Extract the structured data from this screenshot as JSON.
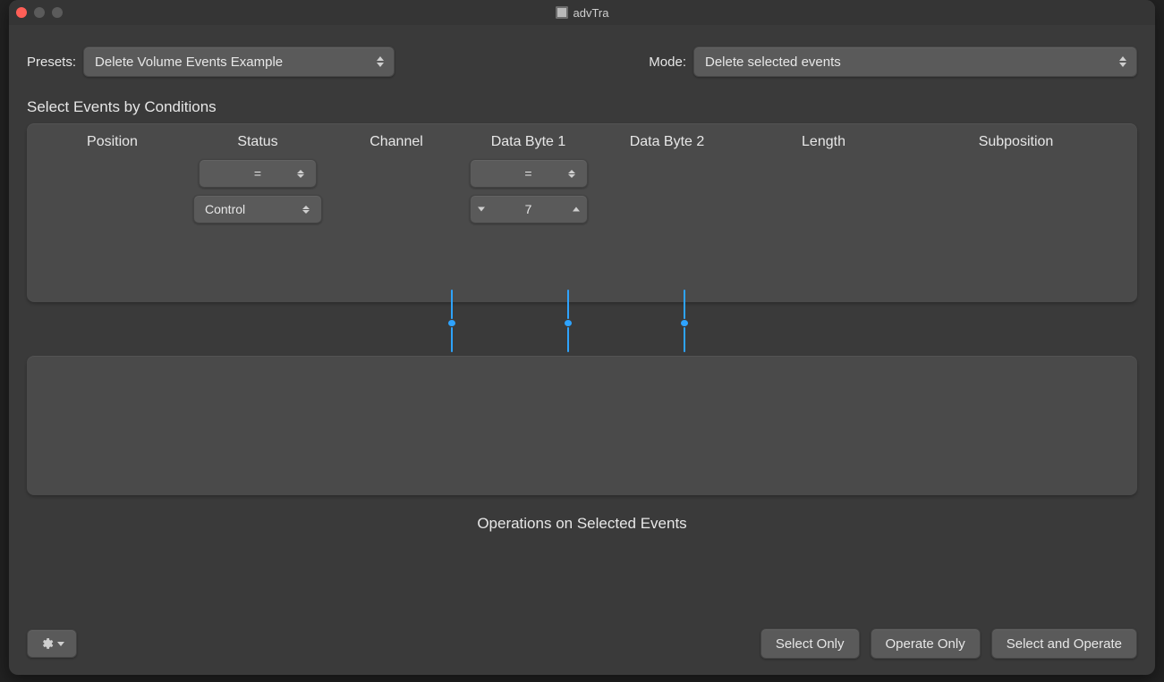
{
  "window": {
    "title": "advTra"
  },
  "toolbar": {
    "presets_label": "Presets:",
    "presets_value": "Delete Volume Events Example",
    "mode_label": "Mode:",
    "mode_value": "Delete selected events"
  },
  "section_select_title": "Select Events by Conditions",
  "columns": {
    "position": "Position",
    "status": "Status",
    "channel": "Channel",
    "db1": "Data Byte 1",
    "db2": "Data Byte 2",
    "length": "Length",
    "subposition": "Subposition"
  },
  "conditions": {
    "status_op": "=",
    "status_val": "Control",
    "db1_op": "=",
    "db1_val": "7"
  },
  "operations_title": "Operations on Selected Events",
  "buttons": {
    "select_only": "Select Only",
    "operate_only": "Operate Only",
    "select_and_operate": "Select and Operate"
  }
}
